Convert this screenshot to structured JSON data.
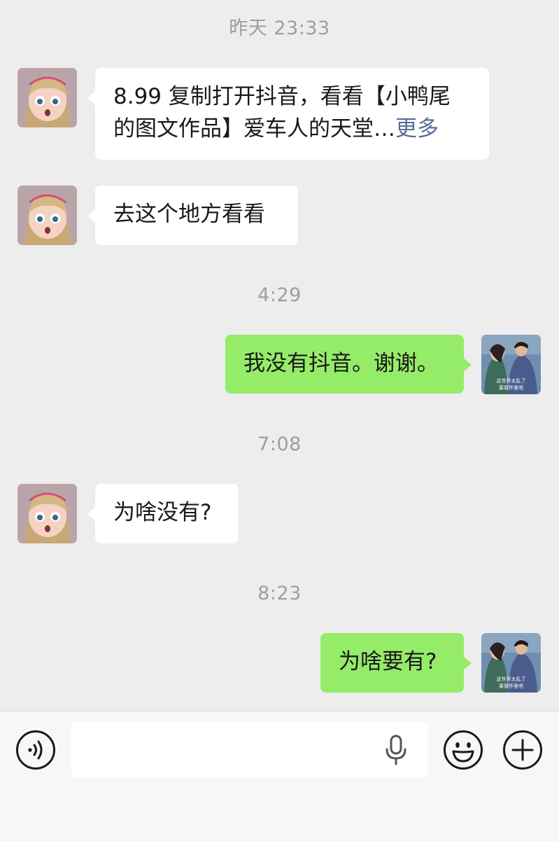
{
  "timestamps": {
    "t1": "昨天 23:33",
    "t2": "4:29",
    "t3": "7:08",
    "t4": "8:23"
  },
  "messages": [
    {
      "from": "other",
      "line1": "8.99 复制打开抖音，看看【小鸭尾",
      "line2": "的图文作品】爱车人的天堂…",
      "more": "更多"
    },
    {
      "from": "other",
      "text": "去这个地方看看"
    },
    {
      "from": "me",
      "text": "我没有抖音。谢谢。"
    },
    {
      "from": "other",
      "text": "为啥没有?"
    },
    {
      "from": "me",
      "text": "为啥要有?"
    }
  ],
  "my_avatar": {
    "caption_line1": "这世界太乱了",
    "caption_line2": "莱我怀里吧"
  },
  "input_bar": {
    "value": "",
    "icons": [
      "voice-icon",
      "mic-icon",
      "emoji-icon",
      "plus-icon"
    ]
  },
  "colors": {
    "background": "#ededed",
    "incoming_bubble": "#ffffff",
    "outgoing_bubble": "#95ec69",
    "link": "#576b95",
    "timestamp": "#9e9e9e"
  }
}
